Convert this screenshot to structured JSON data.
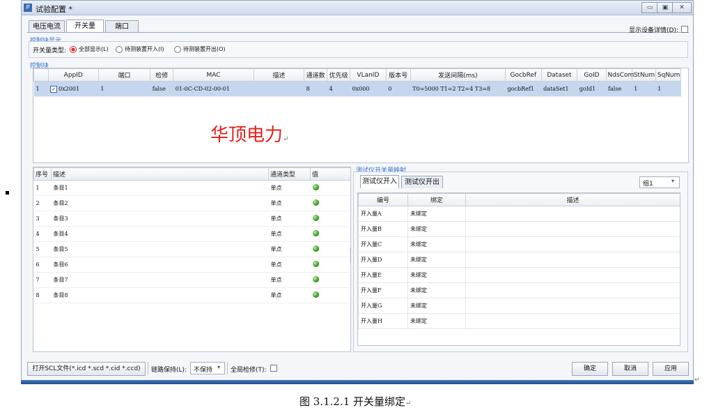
{
  "window": {
    "title": "试验配置 *",
    "app_icon_text": "P",
    "min_glyph": "▭",
    "max_glyph": "▣",
    "close_glyph": "✕"
  },
  "tabs": [
    "电压电流",
    "开关量",
    "端口"
  ],
  "device_detail": {
    "label": "显示设备详情(D):",
    "checked": false
  },
  "control_display": {
    "group_label": "控制块显示",
    "type_label": "开关量类型:",
    "options": [
      "全部显示(L)",
      "待测装置开入(I)",
      "待测装置开出(O)"
    ],
    "selected_index": 0
  },
  "control_block": {
    "group_label": "控制块",
    "columns": [
      "",
      "AppID",
      "端口",
      "检修",
      "MAC",
      "描述",
      "通道数",
      "优先级",
      "VLanID",
      "版本号",
      "发送间隔(ms)",
      "GocbRef",
      "Dataset",
      "GoID",
      "NdsCom",
      "StNum",
      "SqNum"
    ],
    "rows": [
      {
        "index": "1",
        "checked": true,
        "appid": "0x2001",
        "port": "1",
        "test": "false",
        "mac": "01-0C-CD-02-00-01",
        "desc": "",
        "channels": "8",
        "priority": "4",
        "vlan": "0x000",
        "version": "0",
        "interval": "T0=5000 T1=2 T2=4 T3=8",
        "gocbref": "gocbRef1",
        "dataset": "dataSet1",
        "goid": "goId1",
        "ndscom": "false",
        "stnum": "1",
        "sqnum": "1"
      }
    ]
  },
  "watermark": {
    "text": "华顶电力",
    "mark": "↵"
  },
  "channels": {
    "columns": [
      "序号",
      "描述",
      "通道类型",
      "值"
    ],
    "rows": [
      {
        "no": "1",
        "desc": "条目1",
        "type": "单点"
      },
      {
        "no": "2",
        "desc": "条目2",
        "type": "单点"
      },
      {
        "no": "3",
        "desc": "条目3",
        "type": "单点"
      },
      {
        "no": "4",
        "desc": "条目4",
        "type": "单点"
      },
      {
        "no": "5",
        "desc": "条目5",
        "type": "单点"
      },
      {
        "no": "6",
        "desc": "条目6",
        "type": "单点"
      },
      {
        "no": "7",
        "desc": "条目7",
        "type": "单点"
      },
      {
        "no": "8",
        "desc": "条目8",
        "type": "单点"
      }
    ]
  },
  "mapping": {
    "group_label": "测试仪开关量映射",
    "tabs": [
      "测试仪开入",
      "测试仪开出"
    ],
    "group_select": "组1",
    "columns": [
      "编号",
      "绑定",
      "描述"
    ],
    "rows": [
      {
        "id": "开入量A",
        "bind": "未绑定",
        "desc": ""
      },
      {
        "id": "开入量B",
        "bind": "未绑定",
        "desc": ""
      },
      {
        "id": "开入量C",
        "bind": "未绑定",
        "desc": ""
      },
      {
        "id": "开入量D",
        "bind": "未绑定",
        "desc": ""
      },
      {
        "id": "开入量E",
        "bind": "未绑定",
        "desc": ""
      },
      {
        "id": "开入量F",
        "bind": "未绑定",
        "desc": ""
      },
      {
        "id": "开入量G",
        "bind": "未绑定",
        "desc": ""
      },
      {
        "id": "开入量H",
        "bind": "未绑定",
        "desc": ""
      }
    ]
  },
  "footer": {
    "open_scl": "打开SCL文件(*.icd *.scd *.cid *.ccd)",
    "link_hold_label": "链路保持(L):",
    "link_hold_value": "不保持",
    "global_test_label": "全局检修(T):",
    "ok": "确定",
    "cancel": "取消",
    "apply": "应用"
  },
  "caption": "图 3.1.2.1 开关量绑定",
  "caption_mark": "↵",
  "colors": {
    "watermark": "#e0201a",
    "selected_row": "#c6d6ee",
    "led_on": "#2f9a1e",
    "group_label": "#3070c8"
  }
}
